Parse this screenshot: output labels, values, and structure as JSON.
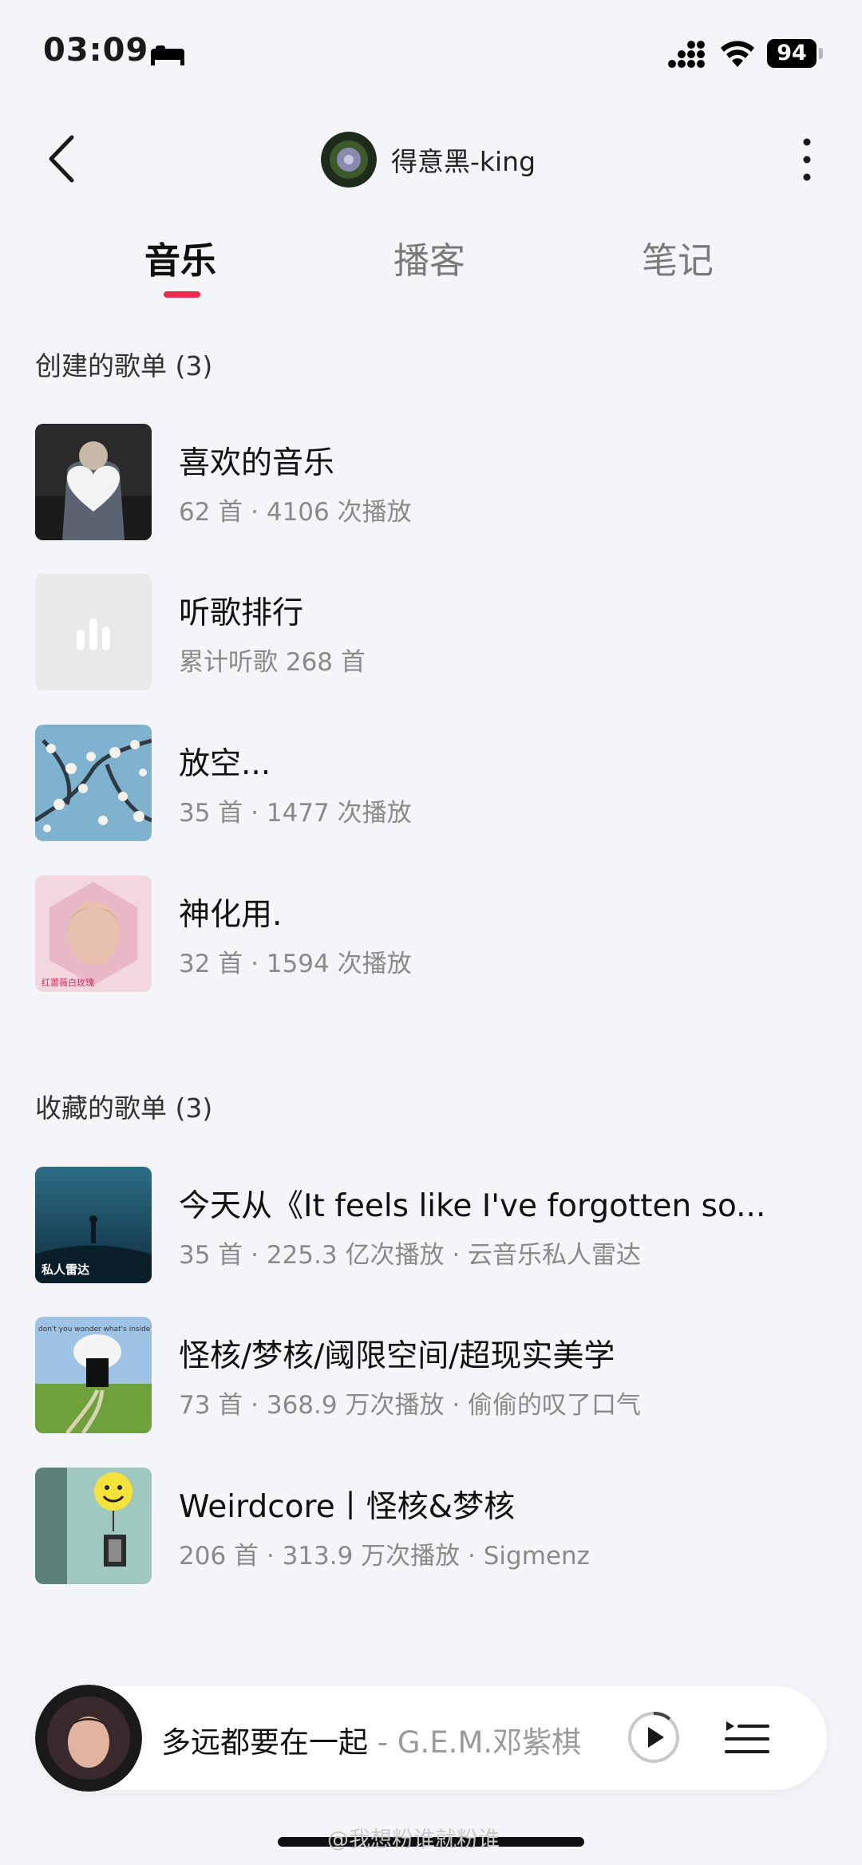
{
  "status_bar": {
    "time": "03:09",
    "battery": "94"
  },
  "header": {
    "user_name": "得意黑-king"
  },
  "tabs": [
    {
      "label": "音乐"
    },
    {
      "label": "播客"
    },
    {
      "label": "笔记"
    }
  ],
  "created": {
    "title": "创建的歌单 (3)",
    "items": [
      {
        "title": "喜欢的音乐",
        "subtitle": "62 首 · 4106 次播放"
      },
      {
        "title": "听歌排行",
        "subtitle": "累计听歌 268 首"
      },
      {
        "title": "放空...",
        "subtitle": "35 首 · 1477 次播放"
      },
      {
        "title": "神化用.",
        "subtitle": "32 首 · 1594 次播放",
        "cover_text": "红蔷薇白玫瑰"
      }
    ]
  },
  "collected": {
    "title": "收藏的歌单 (3)",
    "items": [
      {
        "title": "今天从《It feels like I've forgotten so...",
        "subtitle": "35 首 · 225.3 亿次播放 · 云音乐私人雷达",
        "cover_text": "私人雷达"
      },
      {
        "title": "怪核/梦核/阈限空间/超现实美学",
        "subtitle": "73 首 · 368.9 万次播放 · 偷偷的叹了口气",
        "cover_text": "don't you wonder what's inside?"
      },
      {
        "title": "Weirdcore丨怪核&梦核",
        "subtitle": "206 首 · 313.9 万次播放 · Sigmenz"
      }
    ]
  },
  "player": {
    "song": "多远都要在一起",
    "artist": " - G.E.M.邓紫棋"
  },
  "watermark": "@我想粉谁就粉谁",
  "colors": {
    "accent": "#ee2a4a",
    "background": "#f4f5f9"
  }
}
